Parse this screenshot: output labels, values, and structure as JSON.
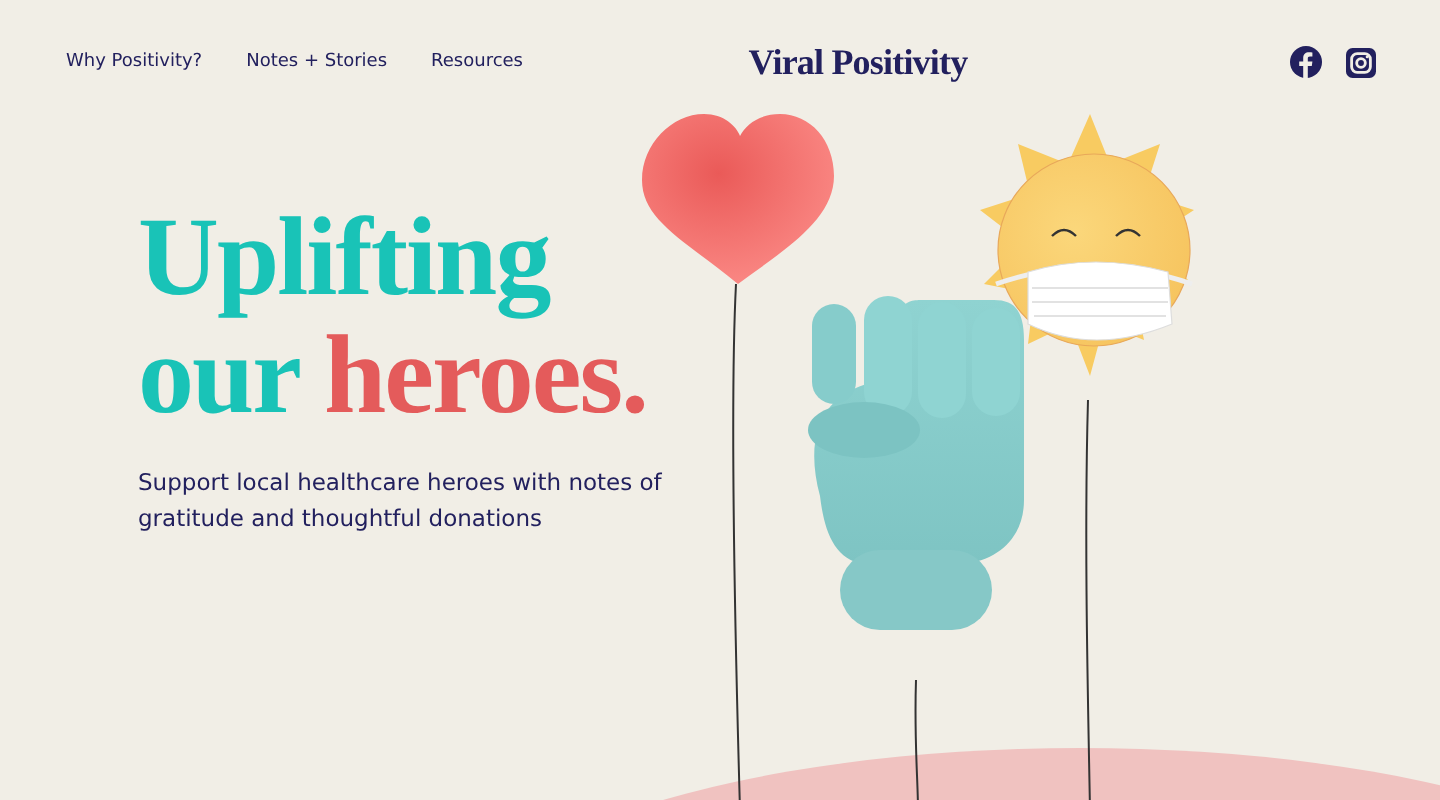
{
  "nav": {
    "links": [
      {
        "label": "Why Positivity?"
      },
      {
        "label": "Notes + Stories"
      },
      {
        "label": "Resources"
      }
    ],
    "logo": "Viral Positivity"
  },
  "hero": {
    "headline": [
      {
        "text": "Uplifting",
        "kind": "plain"
      },
      {
        "text": "our",
        "kind": "plain"
      },
      {
        "text": "heroes.",
        "kind": "highlight"
      }
    ],
    "subtitle": "Support local healthcare heroes with notes of gratitude and thoughtful donations"
  }
}
